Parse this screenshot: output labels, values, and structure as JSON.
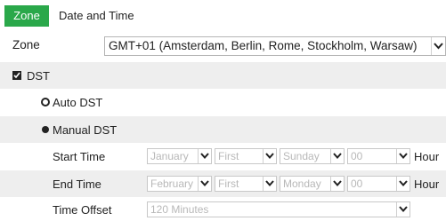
{
  "tabs": {
    "zone": "Zone",
    "date_time": "Date and Time"
  },
  "zone": {
    "label": "Zone",
    "value": "GMT+01 (Amsterdam, Berlin, Rome, Stockholm, Warsaw)"
  },
  "dst": {
    "label": "DST",
    "checked": true
  },
  "auto_dst": {
    "label": "Auto DST",
    "selected": true
  },
  "manual_dst": {
    "label": "Manual DST",
    "selected": false
  },
  "start_time": {
    "label": "Start Time",
    "month": "January",
    "week": "First",
    "day": "Sunday",
    "hour": "00",
    "unit": "Hour"
  },
  "end_time": {
    "label": "End Time",
    "month": "February",
    "week": "First",
    "day": "Monday",
    "hour": "00",
    "unit": "Hour"
  },
  "time_offset": {
    "label": "Time Offset",
    "value": "120 Minutes"
  },
  "colors": {
    "accent": "#2aa84a",
    "row_bg": "#eeeeee",
    "disabled_text": "#b8b8b8"
  },
  "icons": {
    "dropdown": "chevron-down-icon",
    "checkbox": "checkbox-checked-icon"
  }
}
